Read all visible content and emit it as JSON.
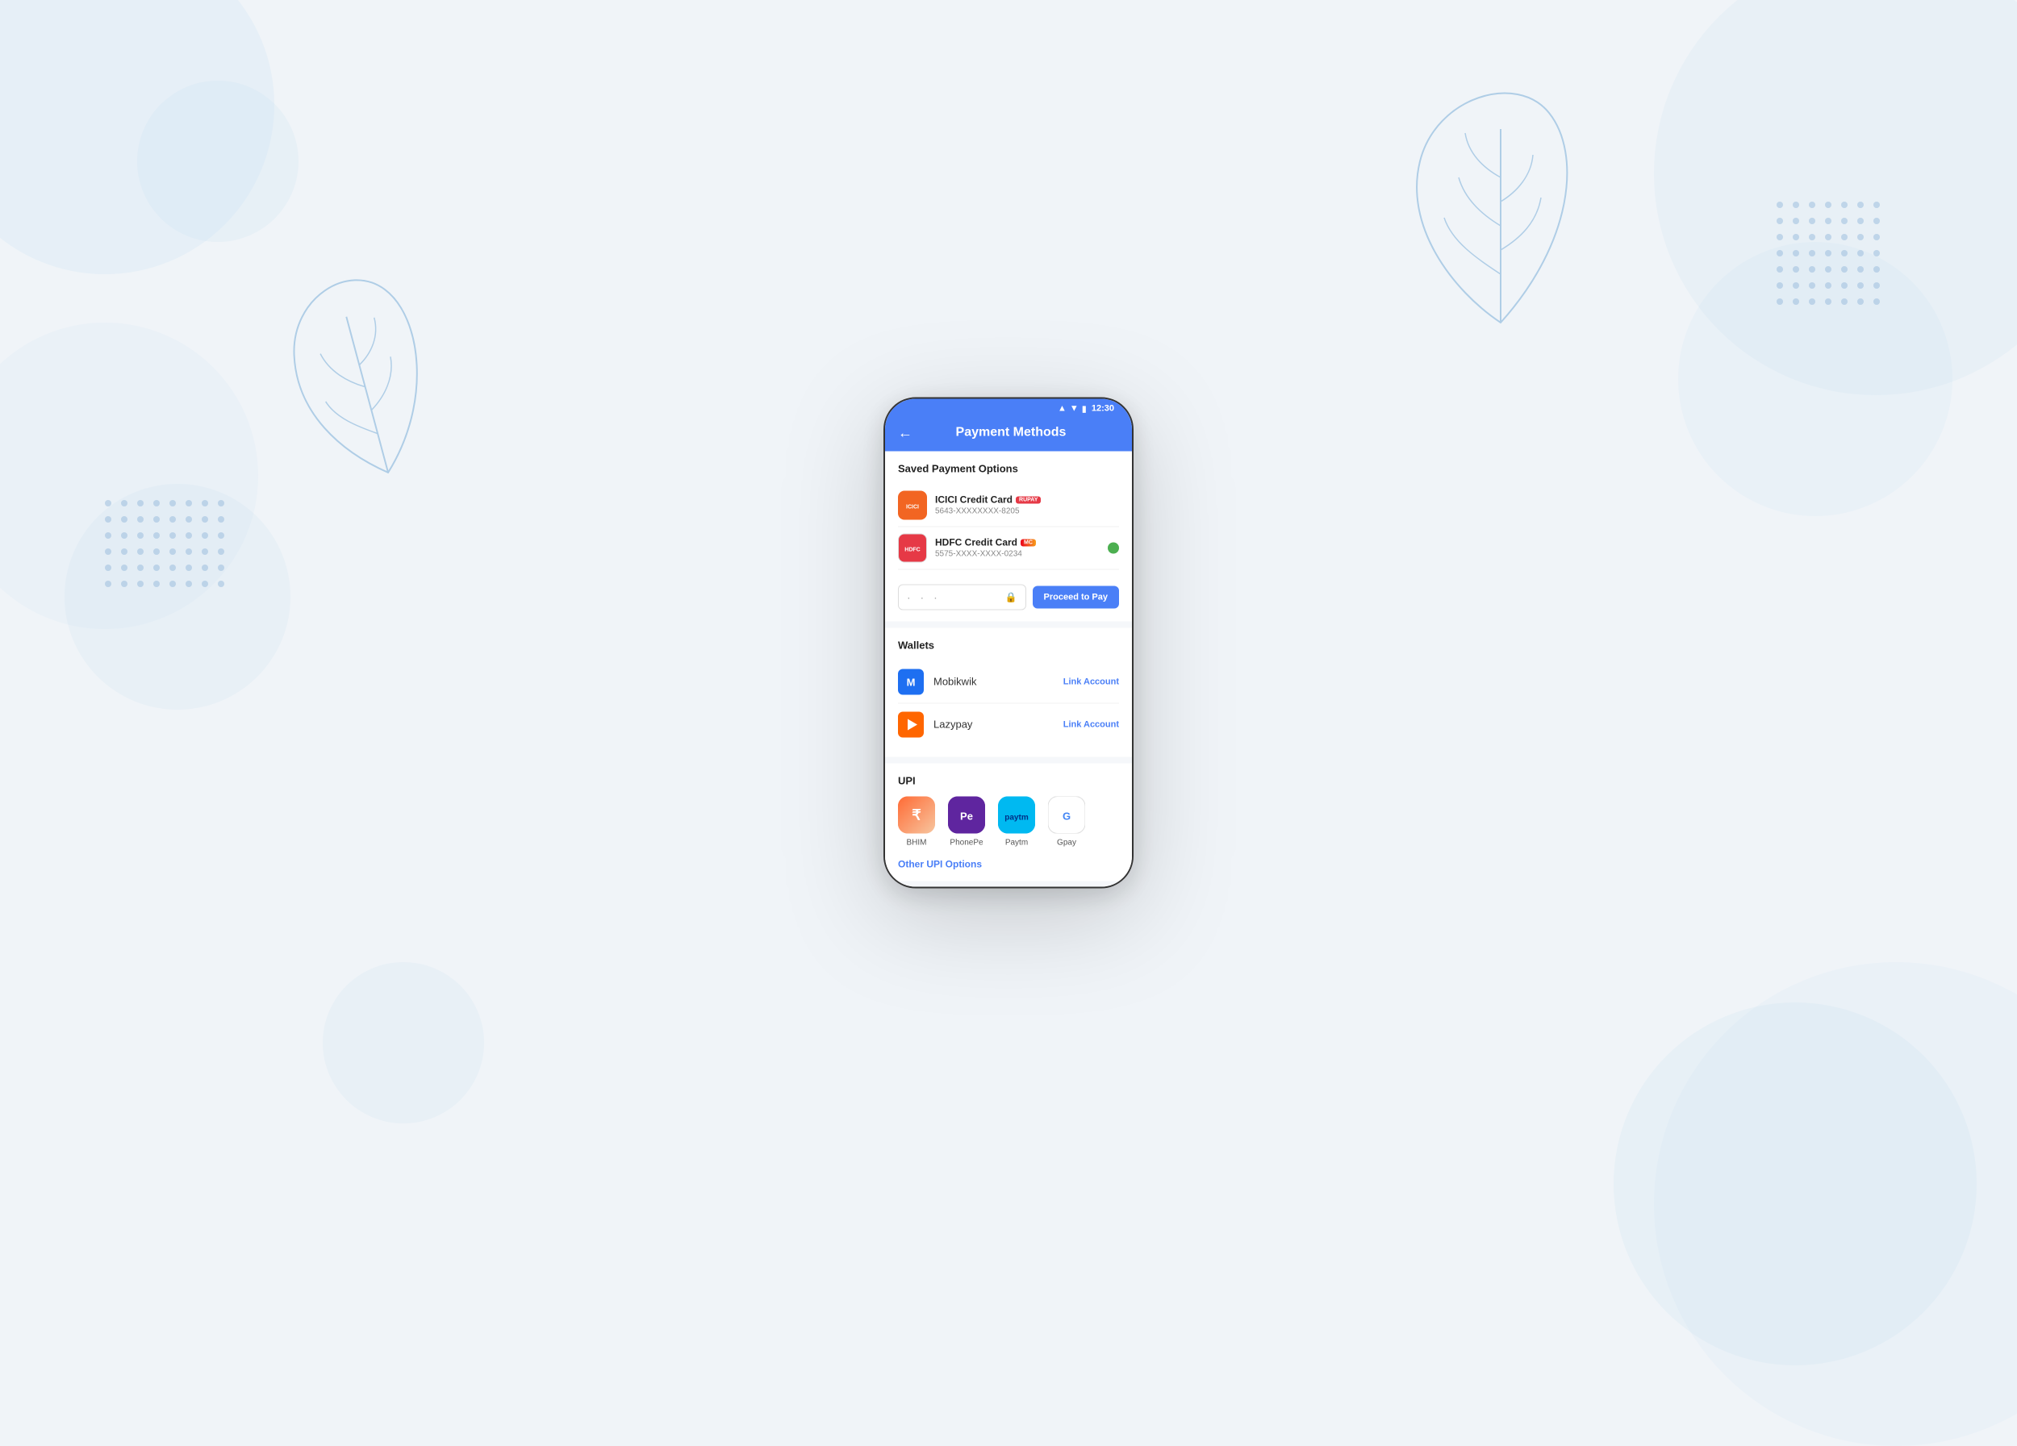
{
  "background": {
    "color": "#eef2f8"
  },
  "status_bar": {
    "time": "12:30",
    "wifi": "▲",
    "signal": "▼",
    "battery": "🔋"
  },
  "header": {
    "title": "Payment Methods",
    "back_label": "←"
  },
  "saved_section": {
    "title": "Saved Payment Options",
    "cards": [
      {
        "name": "ICICI Credit Card",
        "number": "5643-XXXXXXXX-8205",
        "logo_text": "ICICI",
        "badge": "RUPAY",
        "selected": false
      },
      {
        "name": "HDFC Credit Card",
        "number": "5575-XXXX-XXXX-0234",
        "logo_text": "HDFC",
        "badge": "MC",
        "selected": true
      }
    ],
    "cvv_placeholder": "· · ·",
    "proceed_btn": "Proceed to Pay"
  },
  "wallets_section": {
    "title": "Wallets",
    "items": [
      {
        "name": "Mobikwik",
        "action": "Link Account",
        "logo_text": "M",
        "logo_bg": "#1e6ff1"
      },
      {
        "name": "Lazypay",
        "action": "Link Account",
        "logo_text": "▶",
        "logo_bg": "#ff6600"
      }
    ]
  },
  "upi_section": {
    "title": "UPI",
    "apps": [
      {
        "name": "BHIM",
        "logo_text": "₹",
        "style": "upi-bhim"
      },
      {
        "name": "PhonePe",
        "logo_text": "Pe",
        "style": "upi-phonepe"
      },
      {
        "name": "Paytm",
        "logo_text": "P",
        "style": "upi-paytm"
      },
      {
        "name": "Gpay",
        "logo_text": "G",
        "style": "upi-gpay"
      }
    ],
    "other_upi": "Other UPI Options"
  }
}
